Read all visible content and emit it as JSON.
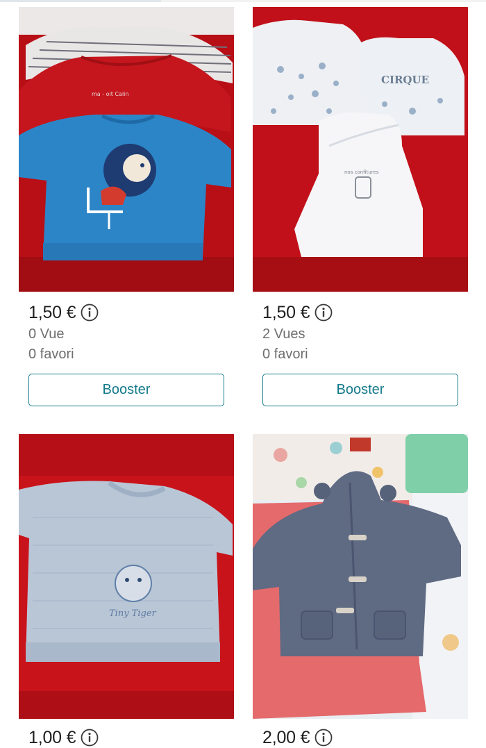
{
  "listings": [
    {
      "price": "1,50 €",
      "views": "0 Vue",
      "favorites": "0 favori",
      "boost_label": "Booster",
      "image_description": "stack of baby tops on red blanket: striped, red, blue with lion"
    },
    {
      "price": "1,50 €",
      "views": "2 Vues",
      "favorites": "0 favori",
      "boost_label": "Booster",
      "image_description": "three white baby bodysuits on red blanket"
    },
    {
      "price": "1,00 €",
      "image_description": "light blue knit sweater with tiger on red blanket"
    },
    {
      "price": "2,00 €",
      "image_description": "grey hooded fleece jacket with toggles on pink mat"
    }
  ],
  "icons": {
    "info": "info-circle-icon"
  },
  "colors": {
    "accent": "#137a8a",
    "muted_text": "#6e6e6e"
  }
}
